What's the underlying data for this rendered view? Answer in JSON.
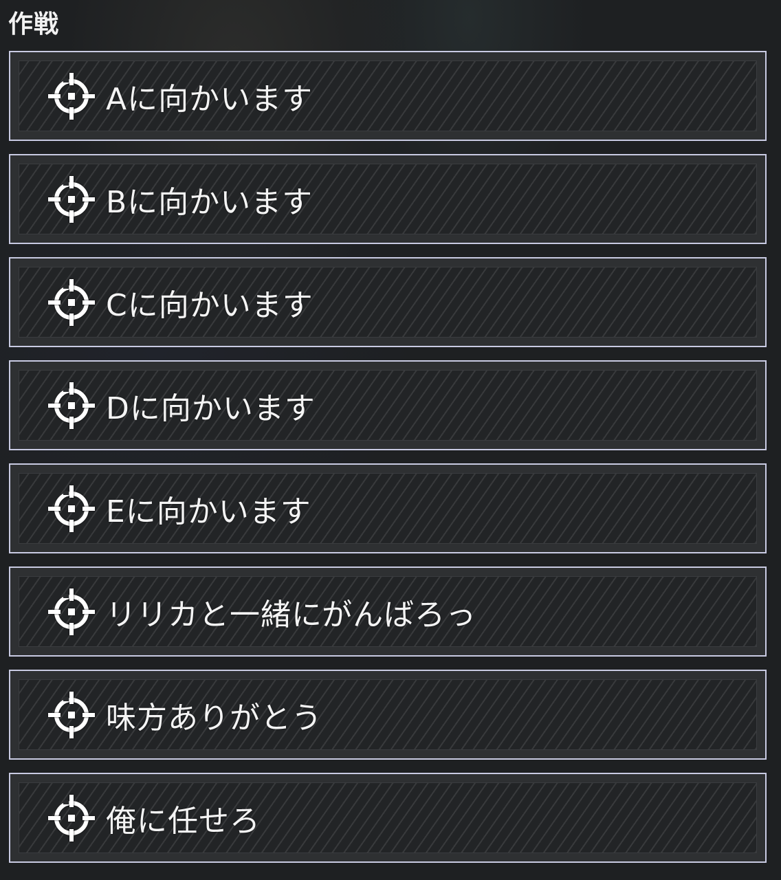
{
  "header": {
    "title": "作戦"
  },
  "options": [
    {
      "label": "Aに向かいます",
      "icon": "crosshair-icon"
    },
    {
      "label": "Bに向かいます",
      "icon": "crosshair-icon"
    },
    {
      "label": "Cに向かいます",
      "icon": "crosshair-icon"
    },
    {
      "label": "Dに向かいます",
      "icon": "crosshair-icon"
    },
    {
      "label": "Eに向かいます",
      "icon": "crosshair-icon"
    },
    {
      "label": "リリカと一緒にがんばろっ",
      "icon": "crosshair-icon"
    },
    {
      "label": "味方ありがとう",
      "icon": "crosshair-icon"
    },
    {
      "label": "俺に任せろ",
      "icon": "crosshair-icon"
    }
  ],
  "colors": {
    "background": "#1e2022",
    "button_border": "#c9cbe3",
    "button_fill": "#222426",
    "text": "#f4f4f4"
  }
}
